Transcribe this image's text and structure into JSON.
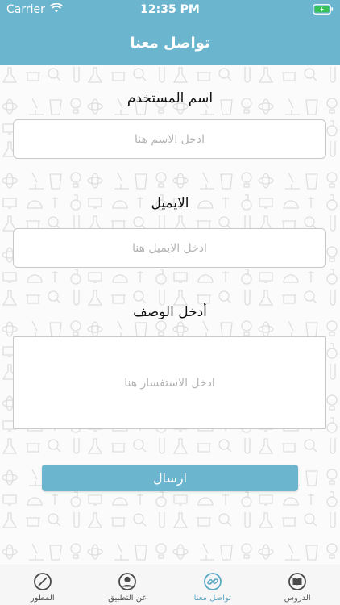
{
  "status_bar": {
    "carrier": "Carrier",
    "time": "12:35 PM"
  },
  "header": {
    "title": "تواصل معنا"
  },
  "form": {
    "username_label": "اسم المستخدم",
    "username_placeholder": "ادخل الاسم هنا",
    "email_label": "الايميل",
    "email_placeholder": "ادخل الايميل هنا",
    "description_label": "أدخل الوصف",
    "description_placeholder": "ادخل الاستفسار هنا",
    "submit_label": "ارسال"
  },
  "tab_bar": {
    "tabs": [
      {
        "label": "المطور",
        "icon": "compass-icon",
        "active": false
      },
      {
        "label": "عن التطبيق",
        "icon": "user-circle-icon",
        "active": false
      },
      {
        "label": "تواصل معنا",
        "icon": "link-icon",
        "active": true
      },
      {
        "label": "الدروس",
        "icon": "book-icon",
        "active": false
      }
    ]
  },
  "colors": {
    "accent": "#6cb5cf",
    "active_tab": "#5aa8c4",
    "pattern": "#d9d9d9"
  }
}
